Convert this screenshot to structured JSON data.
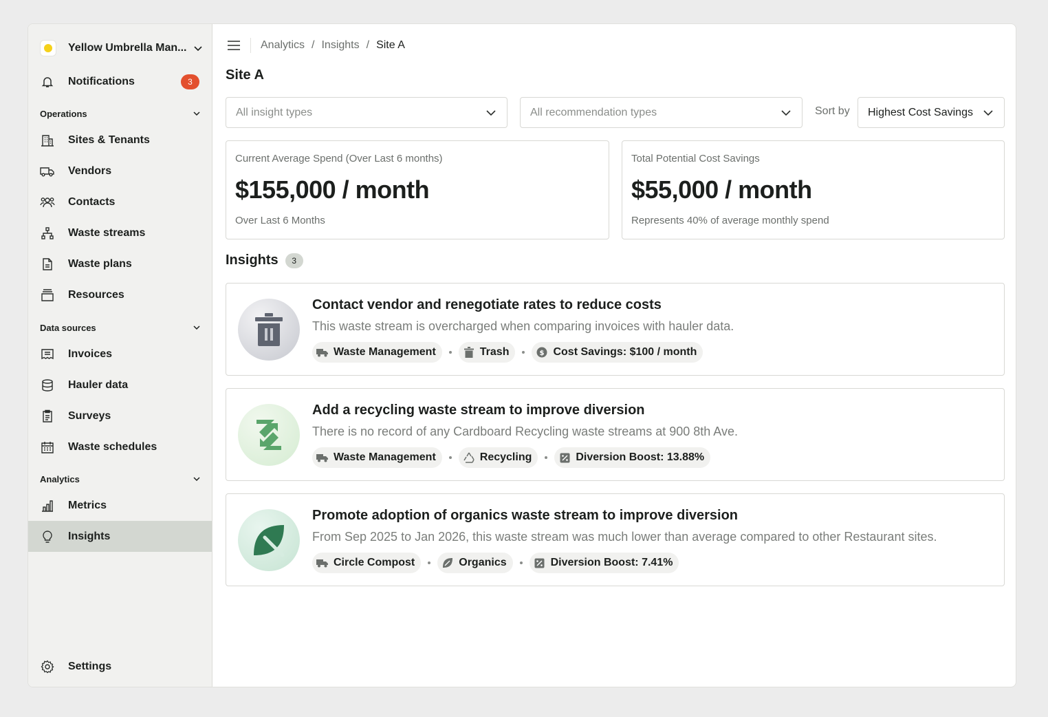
{
  "sidebar": {
    "org_name": "Yellow Umbrella Man...",
    "notifications": {
      "label": "Notifications",
      "count": "3"
    },
    "sections": {
      "operations": "Operations",
      "data_sources": "Data sources",
      "analytics": "Analytics"
    },
    "items": {
      "sites": "Sites & Tenants",
      "vendors": "Vendors",
      "contacts": "Contacts",
      "waste_streams": "Waste streams",
      "waste_plans": "Waste plans",
      "resources": "Resources",
      "invoices": "Invoices",
      "hauler_data": "Hauler data",
      "surveys": "Surveys",
      "waste_schedules": "Waste schedules",
      "metrics": "Metrics",
      "insights": "Insights"
    },
    "settings": "Settings"
  },
  "breadcrumb": {
    "analytics": "Analytics",
    "insights": "Insights",
    "site": "Site A"
  },
  "page_title": "Site A",
  "filters": {
    "insight_types_placeholder": "All insight types",
    "recommendation_types_placeholder": "All recommendation types",
    "sort_label": "Sort by",
    "sort_value": "Highest Cost Savings"
  },
  "stats": {
    "spend": {
      "label": "Current Average Spend (Over Last 6 months)",
      "value": "$155,000 / month",
      "sub": "Over Last 6 Months"
    },
    "savings": {
      "label": "Total Potential Cost Savings",
      "value": "$55,000 / month",
      "sub": "Represents 40% of average monthly spend"
    }
  },
  "insights": {
    "title": "Insights",
    "count": "3",
    "cards": [
      {
        "title": "Contact vendor and renegotiate rates to reduce costs",
        "description": "This waste stream is overcharged when comparing invoices with hauler data.",
        "tags": [
          "Waste Management",
          "Trash",
          "Cost Savings: $100 / month"
        ],
        "icon": "trash-icon"
      },
      {
        "title": "Add a recycling waste stream to improve diversion",
        "description": "There is no record of any Cardboard Recycling waste streams at 900 8th Ave.",
        "tags": [
          "Waste Management",
          "Recycling",
          "Diversion Boost: 13.88%"
        ],
        "icon": "recycle-icon"
      },
      {
        "title": "Promote adoption of organics waste stream to improve diversion",
        "description": "From Sep 2025 to Jan 2026, this waste stream was much lower than average compared to other Restaurant sites.",
        "tags": [
          "Circle Compost",
          "Organics",
          "Diversion Boost: 7.41%"
        ],
        "icon": "leaf-icon"
      }
    ]
  },
  "colors": {
    "accent_active": "#d3d7d1",
    "badge": "#e3502e",
    "trash_gray": "#5f6470",
    "recycle_green": "#5aa56b",
    "organics_green": "#2f7a52"
  }
}
